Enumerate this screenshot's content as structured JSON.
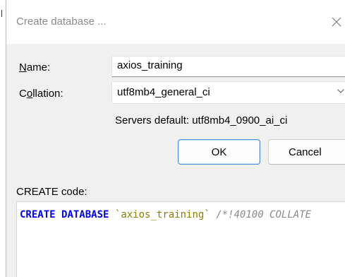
{
  "dialog": {
    "title": "Create database ...",
    "close_icon": "close-icon"
  },
  "form": {
    "name_label_access": "N",
    "name_label_rest": "ame:",
    "name_value": "axios_training",
    "collation_label_pre": "C",
    "collation_label_access": "o",
    "collation_label_rest": "llation:",
    "collation_value": "utf8mb4_general_ci",
    "servers_default": "Servers default: utf8mb4_0900_ai_ci"
  },
  "buttons": {
    "ok": "OK",
    "cancel": "Cancel"
  },
  "code": {
    "label": "CREATE code:",
    "kw1": "CREATE",
    "kw2": "DATABASE",
    "ident": "`axios_training`",
    "comment": "/*!40100 COLLATE"
  },
  "colors": {
    "keyword": "#0000ee",
    "identifier": "#8a8000",
    "comment": "#8a8a8a",
    "ok_border": "#4f8fd6"
  }
}
